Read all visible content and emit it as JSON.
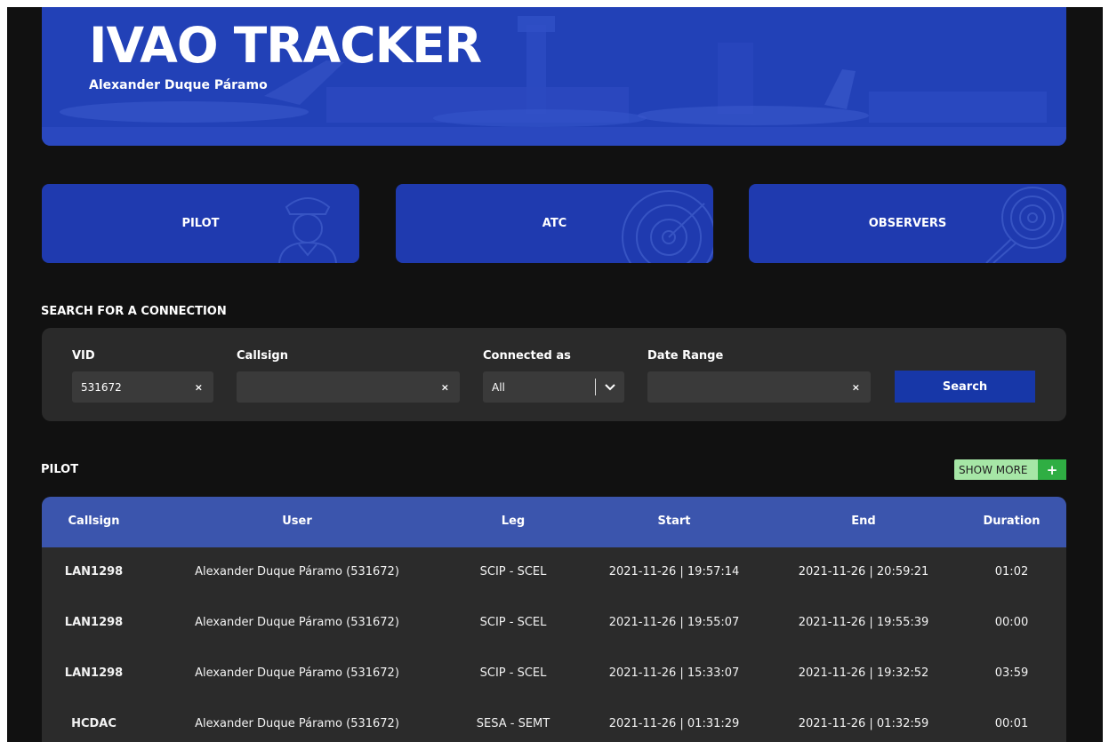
{
  "header": {
    "title": "IVAO TRACKER",
    "subtitle": "Alexander Duque Páramo"
  },
  "categories": [
    {
      "label": "PILOT",
      "icon": "pilot-icon"
    },
    {
      "label": "ATC",
      "icon": "radar-icon"
    },
    {
      "label": "OBSERVERS",
      "icon": "observer-radar-icon"
    }
  ],
  "search": {
    "title": "SEARCH FOR A CONNECTION",
    "vid_label": "VID",
    "vid_value": "531672",
    "callsign_label": "Callsign",
    "callsign_value": "",
    "connected_label": "Connected as",
    "connected_value": "All",
    "date_label": "Date Range",
    "date_value": "",
    "clear_symbol": "×",
    "button_label": "Search"
  },
  "pilot_section": {
    "title": "PILOT",
    "show_more_label": "SHOW MORE",
    "show_more_symbol": "+",
    "columns": [
      "Callsign",
      "User",
      "Leg",
      "Start",
      "End",
      "Duration"
    ],
    "rows": [
      [
        "LAN1298",
        "Alexander Duque Páramo (531672)",
        "SCIP - SCEL",
        "2021-11-26 | 19:57:14",
        "2021-11-26 | 20:59:21",
        "01:02"
      ],
      [
        "LAN1298",
        "Alexander Duque Páramo (531672)",
        "SCIP - SCEL",
        "2021-11-26 | 19:55:07",
        "2021-11-26 | 19:55:39",
        "00:00"
      ],
      [
        "LAN1298",
        "Alexander Duque Páramo (531672)",
        "SCIP - SCEL",
        "2021-11-26 | 15:33:07",
        "2021-11-26 | 19:32:52",
        "03:59"
      ],
      [
        "HCDAC",
        "Alexander Duque Páramo (531672)",
        "SESA - SEMT",
        "2021-11-26 | 01:31:29",
        "2021-11-26 | 01:32:59",
        "00:01"
      ]
    ]
  },
  "colors": {
    "page_bg": "#111111",
    "brand_blue": "#1f3aaf",
    "table_header": "#3b55ad",
    "panel": "#2a2a2a",
    "show_more_bg": "#a6e6a6",
    "show_more_plus": "#2fae43"
  }
}
